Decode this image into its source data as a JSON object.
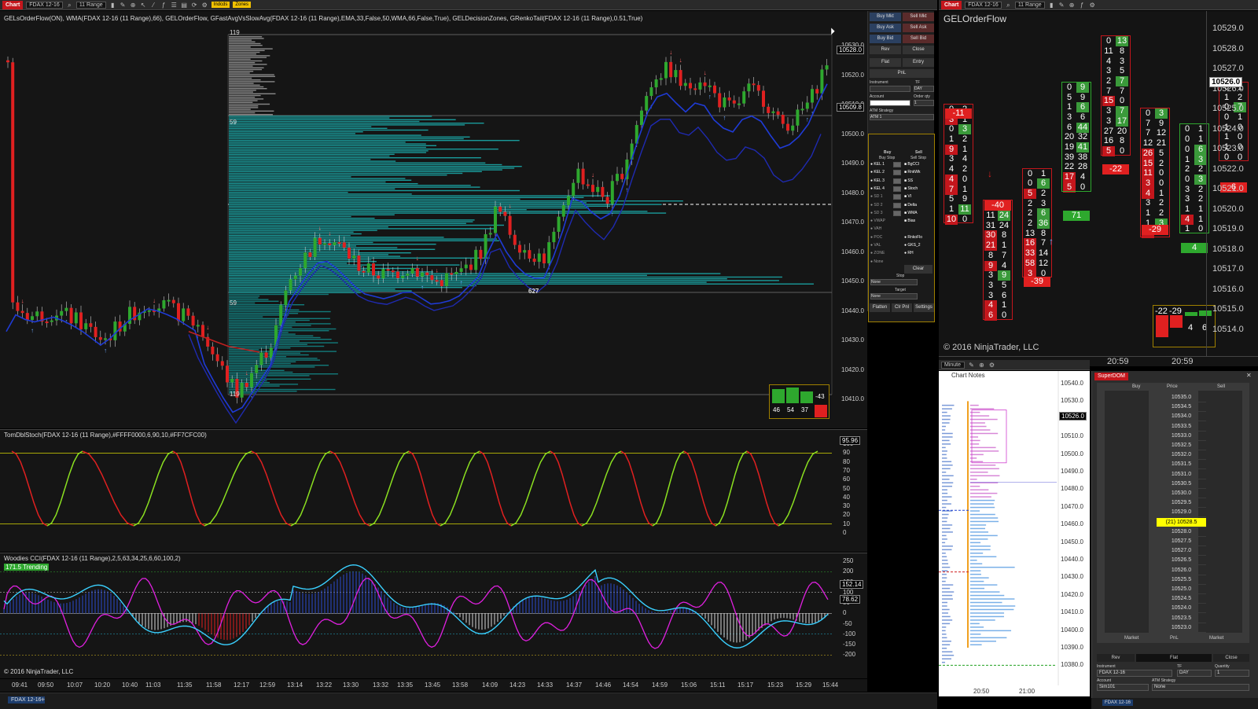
{
  "main_toolbar": {
    "tab": "Chart",
    "instrument": "FDAX 12-16",
    "interval": "11 Range",
    "badges": [
      "Indcds",
      "Zones"
    ]
  },
  "main_chart": {
    "title": "GELsOrderFlow(ON), WMA(FDAX 12-16 (11 Range),66), GELOrderFlow, GFastAvgVsSlowAvg(FDAX 12-16 (11 Range),EMA,33,False,50,WMA,66,False,True), GELDecisionZones, GRenkoTail(FDAX 12-16 (11 Range),0.51,True)",
    "y_labels": [
      "10530.0",
      "10520.0",
      "10510.0",
      "10500.0",
      "10490.0",
      "10480.0",
      "10470.0",
      "10460.0",
      "10450.0",
      "10440.0",
      "10430.0",
      "10420.0",
      "10410.0"
    ],
    "price_tags": [
      "10528.0",
      "10509.8"
    ],
    "profile_labels": [
      "119",
      "59",
      "59",
      "119",
      "627"
    ],
    "delta_box": {
      "values": [
        "46",
        "54",
        "37"
      ],
      "delta": "-43"
    }
  },
  "stoch": {
    "title": "TomDblStoch(FDAX 12-16 (11 Range),#FFFF0000,6,90,10,#FF7CFC00)",
    "y_labels": [
      "100",
      "90",
      "80",
      "70",
      "60",
      "50",
      "40",
      "30",
      "20",
      "10",
      "0"
    ],
    "value_tag": "95.96"
  },
  "cci": {
    "title": "Woodies CCI(FDAX 12-16 (11 Range),2,5,63,34,25,6,60,100,2)",
    "trend_badge": "171.5 Trending",
    "y_labels": [
      "250",
      "200",
      "150",
      "100",
      "50",
      "0",
      "-50",
      "-100",
      "-150",
      "-200"
    ],
    "value_tags": [
      "152.14",
      "78.62"
    ],
    "copyright": "© 2016 NinjaTrader, LLC"
  },
  "x_axis": [
    "09:41",
    "09:50",
    "10:07",
    "10:20",
    "10:40",
    "11:03",
    "11:35",
    "11:58",
    "12:17",
    "12:59",
    "13:14",
    "13:22",
    "13:30",
    "13:32",
    "13:35",
    "13:45",
    "13:58",
    "14:09",
    "14:23",
    "14:33",
    "14:37",
    "14:46",
    "14:54",
    "14:59",
    "15:06",
    "15:11",
    "15:17",
    "15:23",
    "15:29",
    "15:44"
  ],
  "bottom_tab": "FDAX 12-16",
  "control_panel": {
    "buttons": [
      "Buy Mkt",
      "Sell Mkt",
      "Buy Ask",
      "Sell Ask",
      "Buy Bid",
      "Sell Bid",
      "Rev",
      "Close",
      "Flat",
      "Entry",
      "PnL"
    ],
    "labels": [
      "Instrument",
      "TF",
      "Account",
      "Order qty",
      "ATM Strategy"
    ],
    "tf_value": "DAY",
    "qty_value": "1",
    "atm_value": "ATM 1",
    "grid_header": [
      "Buy",
      "Sell",
      "Buy Stop",
      "Sell Stop"
    ],
    "levels_left": [
      "KEL 1",
      "KEL 2",
      "KEL 3",
      "KEL 4",
      "SD 1",
      "SD 2",
      "SD 3",
      "VWAP",
      "VAH",
      "POC",
      "VAL",
      "ZONE",
      "None"
    ],
    "levels_right": [
      "BgCCI",
      "RnkWk",
      "SS",
      "Stoch",
      "VI",
      "Delta",
      "WMA",
      "Bias",
      "",
      "RnkoFlo",
      "GKS_2",
      "RH"
    ],
    "clear": "Clear",
    "stop_label": "Stop",
    "stop_value": "None",
    "target_label": "Target",
    "target_value": "None",
    "bottom_buttons": [
      "Flatten",
      "Clr Pnl",
      "Settings"
    ]
  },
  "orderflow": {
    "tab": "Chart",
    "instrument": "FDAX 12-16",
    "interval": "11 Range",
    "title": "GELOrderFlow",
    "y_labels": [
      "10529.0",
      "10528.0",
      "10527.0",
      "10526.0",
      "10525.0",
      "10524.0",
      "10523.0",
      "10522.0",
      "10521.0",
      "10520.0",
      "10519.0",
      "10518.0",
      "10517.0",
      "10516.0",
      "10515.0",
      "10514.0"
    ],
    "current_price": "10526.0",
    "copyright": "© 2016 NinjaTrader, LLC",
    "x_labels": [
      "20:59",
      "20:59"
    ],
    "col1_delta": "-11",
    "col1": [
      [
        "0",
        "2"
      ],
      [
        "3",
        "1"
      ],
      [
        "0",
        "3"
      ],
      [
        "1",
        "2"
      ],
      [
        "9",
        "1"
      ],
      [
        "3",
        "4"
      ],
      [
        "4",
        "2"
      ],
      [
        "4",
        "0"
      ],
      [
        "7",
        "1"
      ],
      [
        "5",
        "9"
      ],
      [
        "1",
        "11"
      ],
      [
        "10",
        "0"
      ]
    ],
    "col2_delta": "-40",
    "col2": [
      [
        "0",
        "6"
      ],
      [
        "11",
        "24"
      ],
      [
        "31",
        "24"
      ],
      [
        "30",
        "8"
      ],
      [
        "21",
        "1"
      ],
      [
        "8",
        "7"
      ],
      [
        "9",
        "4"
      ],
      [
        "3",
        "9"
      ],
      [
        "3",
        "5"
      ],
      [
        "3",
        "6"
      ],
      [
        "4",
        "1"
      ],
      [
        "6",
        "0"
      ]
    ],
    "col3_delta": "-39",
    "col3": [
      [
        "0",
        "1"
      ],
      [
        "0",
        "6"
      ],
      [
        "5",
        "2"
      ],
      [
        "2",
        "3"
      ],
      [
        "2",
        "6"
      ],
      [
        "2",
        "36"
      ],
      [
        "13",
        "8"
      ],
      [
        "16",
        "7"
      ],
      [
        "33",
        "14"
      ],
      [
        "58",
        "12"
      ],
      [
        "3",
        "0"
      ]
    ],
    "col4_delta": "71",
    "col4": [
      [
        "0",
        "9"
      ],
      [
        "5",
        "9"
      ],
      [
        "1",
        "6"
      ],
      [
        "3",
        "6"
      ],
      [
        "6",
        "44"
      ],
      [
        "20",
        "32"
      ],
      [
        "19",
        "41"
      ],
      [
        "39",
        "38"
      ],
      [
        "22",
        "28"
      ],
      [
        "17",
        "4"
      ],
      [
        "5",
        "0"
      ]
    ],
    "col5_delta": "-22",
    "col5": [
      [
        "0",
        "13"
      ],
      [
        "11",
        "8"
      ],
      [
        "4",
        "3"
      ],
      [
        "3",
        "5"
      ],
      [
        "2",
        "7"
      ],
      [
        "7",
        "7"
      ],
      [
        "15",
        "0"
      ],
      [
        "3",
        "7"
      ],
      [
        "3",
        "17"
      ],
      [
        "27",
        "20"
      ],
      [
        "16",
        "8"
      ],
      [
        "5",
        "0"
      ]
    ],
    "col6_delta": "-29",
    "col6": [
      [
        "0",
        "3"
      ],
      [
        "7",
        "9"
      ],
      [
        "7",
        "12"
      ],
      [
        "12",
        "21"
      ],
      [
        "26",
        "5"
      ],
      [
        "15",
        "2"
      ],
      [
        "11",
        "0"
      ],
      [
        "3",
        "0"
      ],
      [
        "4",
        "1"
      ],
      [
        "3",
        "2"
      ],
      [
        "1",
        "2"
      ],
      [
        "1",
        "3"
      ],
      [
        "3",
        "0"
      ]
    ],
    "col7_delta": "4",
    "col7": [
      [
        "0",
        "1"
      ],
      [
        "0",
        "1"
      ],
      [
        "0",
        "6"
      ],
      [
        "1",
        "3"
      ],
      [
        "2",
        "2"
      ],
      [
        "0",
        "3"
      ],
      [
        "3",
        "2"
      ],
      [
        "3",
        "2"
      ],
      [
        "1",
        "1"
      ],
      [
        "4",
        "1"
      ],
      [
        "1",
        "0"
      ]
    ],
    "col8_delta": "6",
    "col8": [
      [
        "0",
        "1"
      ],
      [
        "1",
        "2"
      ],
      [
        "0",
        "7"
      ],
      [
        "0",
        "1"
      ],
      [
        "1",
        "0"
      ],
      [
        "1",
        "0"
      ],
      [
        "1",
        "0"
      ],
      [
        "0",
        "0"
      ]
    ],
    "summary": {
      "a": "-22",
      "b": "-29",
      "c": "4",
      "d": "6"
    }
  },
  "notes_chart": {
    "title": "Chart Notes",
    "interval": "Minute",
    "y_labels": [
      "10540.0",
      "10530.0",
      "10520.0",
      "10510.0",
      "10500.0",
      "10490.0",
      "10480.0",
      "10470.0",
      "10460.0",
      "10450.0",
      "10440.0",
      "10430.0",
      "10420.0",
      "10410.0",
      "10400.0",
      "10390.0",
      "10380.0"
    ],
    "price_tag": "10526.0",
    "x_labels": [
      "20:50",
      "21:00"
    ]
  },
  "dom": {
    "tab": "SuperDOM",
    "headers": [
      "Buy",
      "Price",
      "Sell"
    ],
    "prices": [
      "10535.0",
      "10534.5",
      "10534.0",
      "10533.5",
      "10533.0",
      "10532.5",
      "10532.0",
      "10531.5",
      "10531.0",
      "10530.5",
      "10530.0",
      "10529.5",
      "10529.0",
      "(21) 10528.5",
      "10528.0",
      "10527.5",
      "10527.0",
      "10526.5",
      "10526.0",
      "10525.5",
      "10525.0",
      "10524.5",
      "10524.0",
      "10523.5",
      "10523.0"
    ],
    "footer": [
      "Market",
      "PnL",
      "Market"
    ],
    "buttons": [
      "Rev",
      "Flat",
      "Close"
    ],
    "labels": [
      "Instrument",
      "TF",
      "Quantity",
      "Account",
      "ATM Strategy"
    ],
    "instrument": "FDAX 12-16",
    "tf": "DAY",
    "qty": "1",
    "account": "Sim101",
    "atm": "None",
    "bottom_tab": "FDAX 12-16"
  },
  "colors": {
    "up": "#2ea82e",
    "down": "#e02020",
    "profile": "#1a9a9a",
    "accent_red": "#c4161c",
    "yellow": "#ffff00"
  }
}
